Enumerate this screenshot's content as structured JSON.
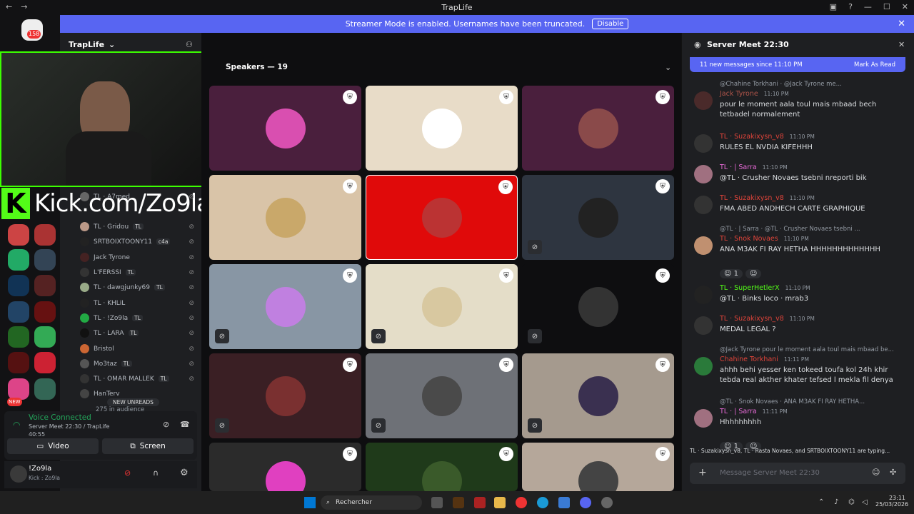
{
  "window": {
    "title": "TrapLife"
  },
  "banner": {
    "text": "Streamer Mode is enabled. Usernames have been truncated.",
    "button": "Disable"
  },
  "rail": {
    "home_badge": "158",
    "new_label": "NEW"
  },
  "server": {
    "name": "TrapLife"
  },
  "overlay": {
    "kick_text": "Kick.com/Zo9la"
  },
  "members": [
    {
      "name": "TL · A7med",
      "tag": ""
    },
    {
      "name": "TL · Gridou",
      "tag": "TL"
    },
    {
      "name": "SRTBOIXTOONY11",
      "tag": "c4a"
    },
    {
      "name": "Jack Tyrone",
      "tag": ""
    },
    {
      "name": "L'FERSSI",
      "tag": "TL"
    },
    {
      "name": "TL · dawgjunky69",
      "tag": "TL"
    },
    {
      "name": "TL · KHLiL",
      "tag": ""
    },
    {
      "name": "TL · !Zo9la",
      "tag": "TL"
    },
    {
      "name": "TL · LARA",
      "tag": "TL"
    },
    {
      "name": "Bristol",
      "tag": ""
    },
    {
      "name": "Mo3taz",
      "tag": "TL"
    },
    {
      "name": "TL · OMAR MALLEK",
      "tag": "TL"
    },
    {
      "name": "HanTerv",
      "tag": ""
    }
  ],
  "new_unreads": "NEW UNREADS",
  "audience": "275 in audience",
  "voice": {
    "status": "Voice Connected",
    "channel": "Server Meet 22:30 / TrapLife",
    "timer": "40:55",
    "video_btn": "Video",
    "screen_btn": "Screen"
  },
  "user": {
    "name": "!Zo9la",
    "status": "Kick : Zo9la"
  },
  "stage": {
    "header": "Speakers — 19"
  },
  "tiles": [
    {
      "bg": "#4a1f3d",
      "pic": "#d94fb0",
      "muted": false
    },
    {
      "bg": "#e8dcc8",
      "pic": "#ffffff",
      "muted": false
    },
    {
      "bg": "#4a1f3d",
      "pic": "#8a4a4a",
      "muted": false
    },
    {
      "bg": "#d9c4a8",
      "pic": "#c9a86a",
      "muted": false
    },
    {
      "bg": "#e00a0a",
      "pic": "#b33",
      "muted": false
    },
    {
      "bg": "#2e3540",
      "pic": "#222",
      "muted": true
    },
    {
      "bg": "#8896a4",
      "pic": "#c080e0",
      "muted": true
    },
    {
      "bg": "#e4ddc8",
      "pic": "#d8c8a0",
      "muted": true
    },
    {
      "bg": "#0e0e10",
      "pic": "#333",
      "muted": true
    },
    {
      "bg": "#3a1f24",
      "pic": "#7a3030",
      "muted": true
    },
    {
      "bg": "#6e7177",
      "pic": "#4a4a4a",
      "muted": true
    },
    {
      "bg": "#a59a8e",
      "pic": "#3a3050",
      "muted": true
    },
    {
      "bg": "#2b2b2b",
      "pic": "#e040c0",
      "muted": false
    },
    {
      "bg": "#1f3a1a",
      "pic": "#3a5a2a",
      "muted": false
    },
    {
      "bg": "#b5a79a",
      "pic": "#444",
      "muted": false
    }
  ],
  "chat": {
    "title": "Server Meet 22:30",
    "new_messages": "11 new messages since 11:10 PM",
    "mark_read": "Mark As Read",
    "input_placeholder": "Message Server Meet 22:30",
    "typing": "TL · Suzakixysn_v8, TL · Rasta Novaes, and SRTBOIXTOONY11 are typing...",
    "messages": [
      {
        "reply": "@Chahine Torkhani · @Jack Tyrone me...",
        "author": "Jack Tyrone",
        "color": "#b0554a",
        "time": "11:10 PM",
        "body": "pour le moment aala toul mais mbaad bech tetbadel normalement",
        "avatar": "#4a2a2a"
      },
      {
        "reply": "",
        "author": "TL · Suzakixysn_v8",
        "color": "#e0443a",
        "time": "11:10 PM",
        "body": "RULES EL NVDIA KIFEHHH",
        "avatar": "#333"
      },
      {
        "reply": "",
        "author": "TL · | Sarra",
        "color": "#e86ad8",
        "time": "11:10 PM",
        "body": "@TL · Crusher Novaes tsebni nreporti bik",
        "avatar": "#a07080"
      },
      {
        "reply": "",
        "author": "TL · Suzakixysn_v8",
        "color": "#e0443a",
        "time": "11:10 PM",
        "body": "FMA ABED ANDHECH CARTE GRAPHIQUE",
        "avatar": "#333"
      },
      {
        "reply": "@TL · | Sarra · @TL · Crusher Novaes tsebni ...",
        "author": "TL · Snok Novaes",
        "color": "#e0443a",
        "time": "11:10 PM",
        "body": "ANA M3AK FI RAY HETHA HHHHHHHHHHHHH",
        "avatar": "#c09070",
        "react": "1"
      },
      {
        "reply": "",
        "author": "TL · SuperHetlerX",
        "color": "#53fc18",
        "time": "11:10 PM",
        "body": "@TL · Binks loco · mrab3",
        "avatar": "#222"
      },
      {
        "reply": "",
        "author": "TL · Suzakixysn_v8",
        "color": "#e0443a",
        "time": "11:10 PM",
        "body": "MEDAL LEGAL ?",
        "avatar": "#333"
      },
      {
        "reply": "@Jack Tyrone pour le moment aala toul mais mbaad be...",
        "author": "Chahine Torkhani",
        "color": "#e0443a",
        "time": "11:11 PM",
        "body": "ahhh behi yesser ken tokeed toufa kol 24h khir tebda real akther khater tefsed l mekla fil denya",
        "avatar": "#2a7a3a"
      },
      {
        "reply": "@TL · Snok Novaes · ANA M3AK FI RAY HETHA...",
        "author": "TL · | Sarra",
        "color": "#e86ad8",
        "time": "11:11 PM",
        "body": "Hhhhhhhhh",
        "avatar": "#a07080",
        "react": "1"
      }
    ]
  },
  "taskbar": {
    "search": "Rechercher",
    "time": "23:11",
    "date": "25/03/2026"
  }
}
